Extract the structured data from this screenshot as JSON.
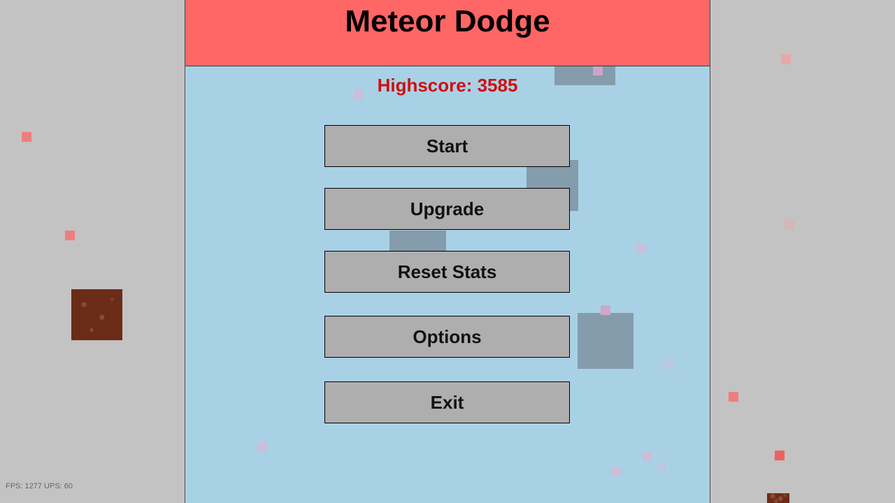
{
  "game": {
    "title": "Meteor Dodge",
    "highscore_text": "Highscore: 3585"
  },
  "menu": {
    "items": [
      {
        "label": "Start"
      },
      {
        "label": "Upgrade"
      },
      {
        "label": "Reset Stats"
      },
      {
        "label": "Options"
      },
      {
        "label": "Exit"
      }
    ]
  },
  "debug": {
    "stats_text": "FPS: 1277 UPS: 60"
  },
  "colors": {
    "background": "#c3c3c3",
    "panel": "#a9d1e6",
    "title_bar": "#ff6666",
    "highscore": "#d00f0f",
    "button": "#aeaeae"
  }
}
